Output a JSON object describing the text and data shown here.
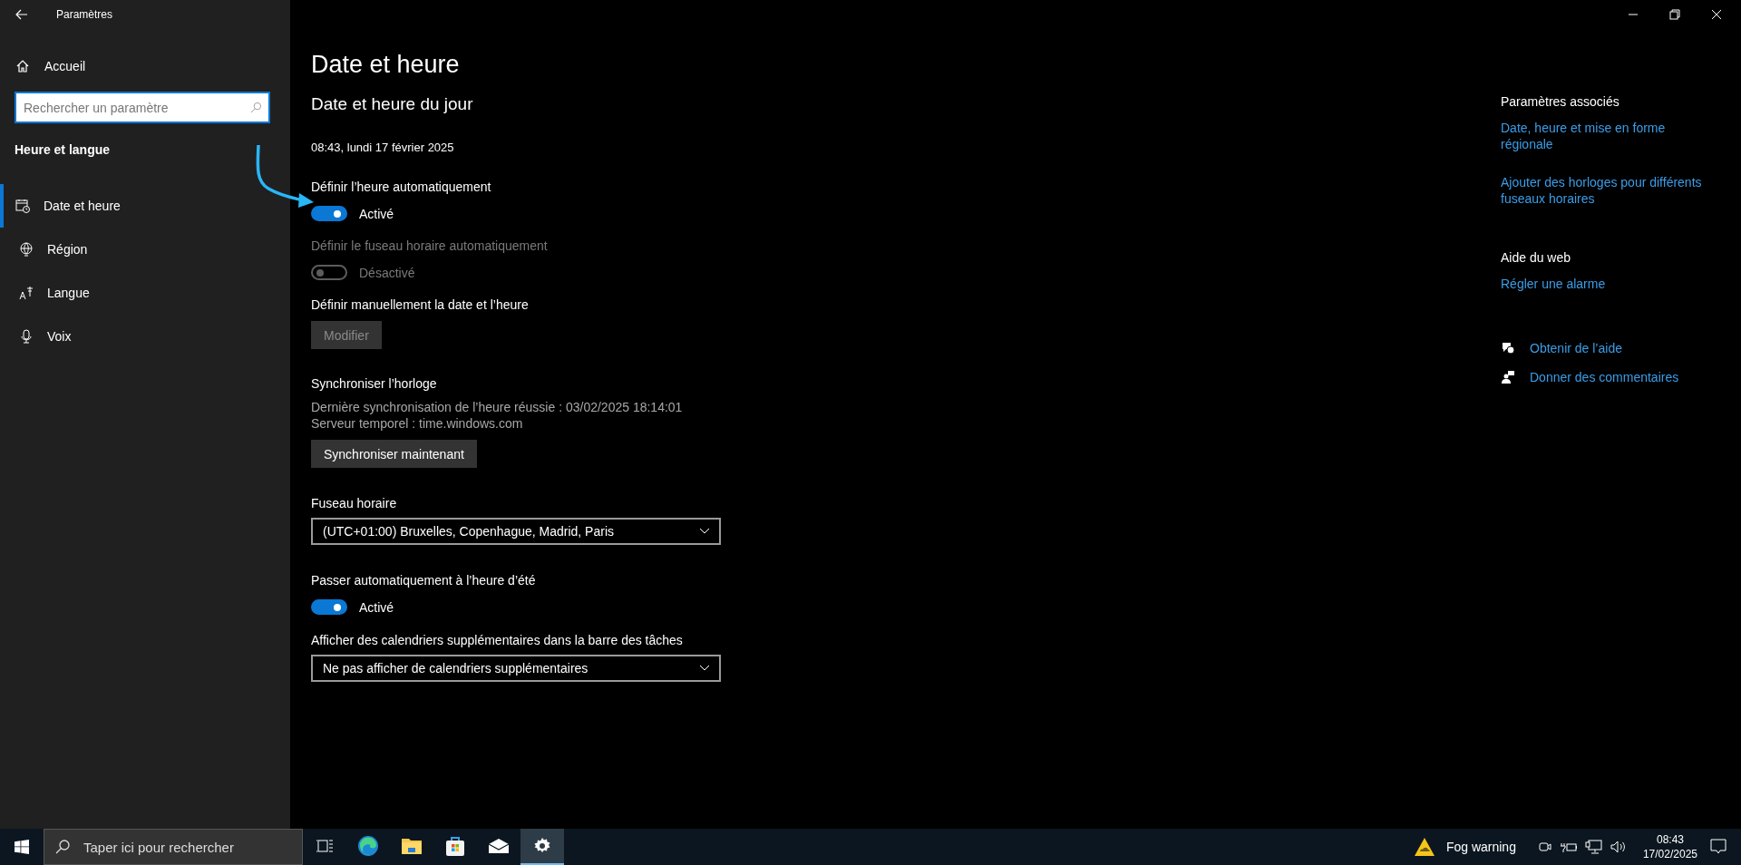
{
  "window": {
    "title": "Paramètres"
  },
  "sidebar": {
    "home": "Accueil",
    "search": {
      "placeholder": "Rechercher un paramètre"
    },
    "section": "Heure et langue",
    "items": [
      {
        "kind": "calendar",
        "label": "Date et heure",
        "selected": true
      },
      {
        "kind": "globe",
        "label": "Région",
        "selected": false
      },
      {
        "kind": "language",
        "label": "Langue",
        "selected": false
      },
      {
        "kind": "mic",
        "label": "Voix",
        "selected": false
      }
    ]
  },
  "page": {
    "title": "Date et heure",
    "subtitle": "Date et heure du jour",
    "current": "08:43, lundi 17 février 2025",
    "settings": [
      {
        "kind": "toggle",
        "label": "Définir l’heure automatiquement",
        "on": true,
        "state_text": "Activé",
        "disabled": false
      },
      {
        "kind": "toggle",
        "label": "Définir le fuseau horaire automatiquement",
        "on": false,
        "state_text": "Désactivé",
        "disabled": true
      },
      {
        "kind": "button",
        "label": "Définir manuellement la date et l’heure",
        "button": "Modifier",
        "disabled": true
      },
      {
        "kind": "sync",
        "label": "Synchroniser l’horloge",
        "lines": [
          "Dernière synchronisation de l’heure réussie : 03/02/2025 18:14:01",
          "Serveur temporel : time.windows.com"
        ],
        "button": "Synchroniser maintenant",
        "disabled": false
      },
      {
        "kind": "dropdown",
        "label": "Fuseau horaire",
        "value": "(UTC+01:00) Bruxelles, Copenhague, Madrid, Paris"
      },
      {
        "kind": "toggle",
        "label": "Passer automatiquement à l’heure d’été",
        "on": true,
        "state_text": "Activé",
        "disabled": false
      },
      {
        "kind": "dropdown",
        "label": "Afficher des calendriers supplémentaires dans la barre des tâches",
        "value": "Ne pas afficher de calendriers supplémentaires"
      }
    ]
  },
  "related": {
    "title": "Paramètres associés",
    "links": [
      "Date, heure et mise en forme régionale",
      "Ajouter des horloges pour différents fuseaux horaires"
    ],
    "web_title": "Aide du web",
    "web_links": [
      "Régler une alarme"
    ],
    "help": [
      {
        "kind": "help",
        "label": "Obtenir de l’aide"
      },
      {
        "kind": "feedback",
        "label": "Donner des commentaires"
      }
    ]
  },
  "taskbar": {
    "search": {
      "placeholder": "Taper ici pour rechercher"
    },
    "apps": [
      {
        "kind": "taskview",
        "active": false
      },
      {
        "kind": "edge",
        "active": false
      },
      {
        "kind": "folder",
        "active": false
      },
      {
        "kind": "store",
        "active": false
      },
      {
        "kind": "mail",
        "active": false
      },
      {
        "kind": "settings",
        "active": true
      }
    ],
    "weather": "Fog warning",
    "time": "08:43",
    "date": "17/02/2025"
  }
}
